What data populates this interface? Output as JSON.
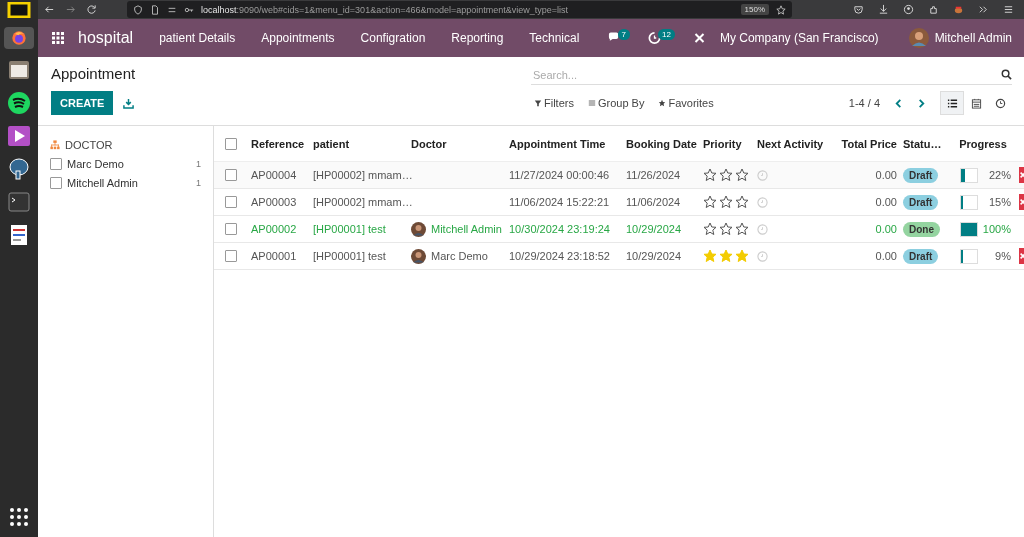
{
  "browser": {
    "url_host": "localhost",
    "url_rest": ":9090/web#cids=1&menu_id=301&action=466&model=appointment&view_type=list",
    "zoom": "150%"
  },
  "navbar": {
    "app": "hospital",
    "menus": [
      "patient Details",
      "Appointments",
      "Configration",
      "Reporting",
      "Technical"
    ],
    "messages_count": "7",
    "activities_count": "12",
    "company": "My Company (San Francisco)",
    "user": "Mitchell Admin"
  },
  "control_panel": {
    "title": "Appointment",
    "create": "CREATE",
    "search_placeholder": "Search...",
    "filters": "Filters",
    "group_by": "Group By",
    "favorites": "Favorites",
    "pager": "1-4 / 4",
    "views": [
      {
        "kind": "list",
        "selected": true
      },
      {
        "kind": "calendar",
        "selected": false
      },
      {
        "kind": "activity",
        "selected": false
      }
    ]
  },
  "sidebar": {
    "heading": "DOCTOR",
    "items": [
      {
        "label": "Marc Demo",
        "count": "1",
        "checked": false
      },
      {
        "label": "Mitchell Admin",
        "count": "1",
        "checked": false
      }
    ]
  },
  "table": {
    "select_all_checked": false,
    "columns": [
      "Reference",
      "patient",
      "Doctor",
      "Appointment Time",
      "Booking Date",
      "Priority",
      "Next Activity",
      "Total Price",
      "Statu…",
      "Progress"
    ],
    "rows": [
      {
        "reference": "AP00004",
        "patient": "[HP00002] mmam…",
        "doctor": "",
        "appointment_time": "11/27/2024 00:00:46",
        "booking_date": "11/26/2024",
        "stars": 0,
        "total_price": "0.00",
        "status": "Draft",
        "kind": "draft",
        "checked": false,
        "level": 0.22,
        "progress": "22%"
      },
      {
        "reference": "AP00003",
        "patient": "[HP00002] mmam…",
        "doctor": "",
        "appointment_time": "11/06/2024 15:22:21",
        "booking_date": "11/06/2024",
        "stars": 0,
        "total_price": "0.00",
        "status": "Draft",
        "kind": "draft",
        "checked": false,
        "level": 0.15,
        "progress": "15%"
      },
      {
        "reference": "AP00002",
        "patient": "[HP00001] test",
        "doctor": "Mitchell Admin",
        "appointment_time": "10/30/2024 23:19:24",
        "booking_date": "10/29/2024",
        "stars": 0,
        "total_price": "0.00",
        "status": "Done",
        "kind": "done",
        "checked": false,
        "level": 1,
        "progress": "100%"
      },
      {
        "reference": "AP00001",
        "patient": "[HP00001] test",
        "doctor": "Marc Demo",
        "appointment_time": "10/29/2024 23:18:52",
        "booking_date": "10/29/2024",
        "stars": 3,
        "total_price": "0.00",
        "status": "Draft",
        "kind": "draft",
        "checked": false,
        "level": 0.09,
        "progress": "9%"
      }
    ]
  }
}
